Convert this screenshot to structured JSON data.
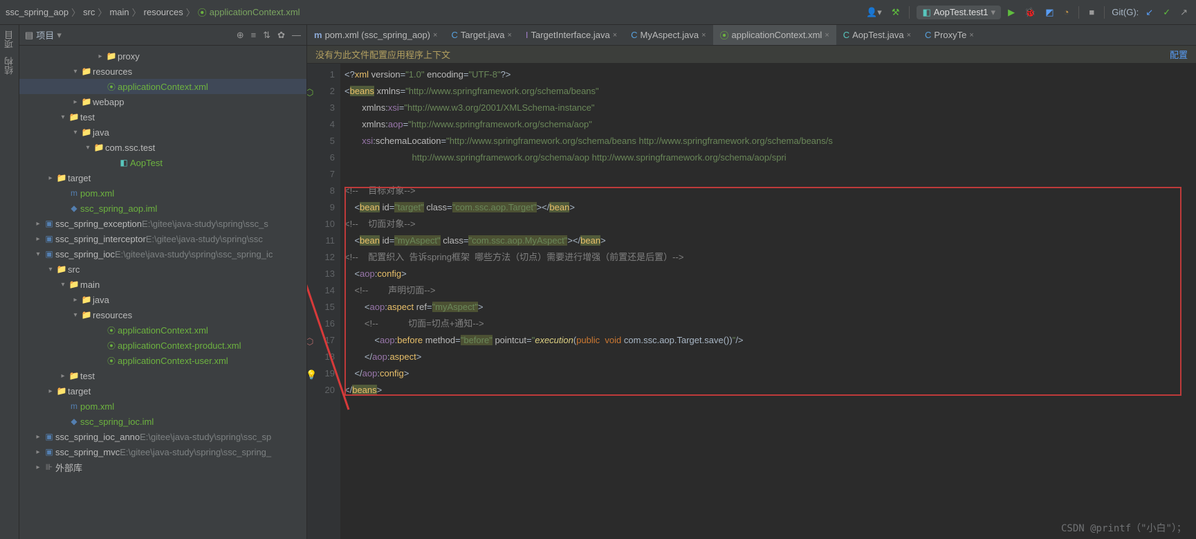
{
  "breadcrumbs": [
    "ssc_spring_aop",
    "src",
    "main",
    "resources",
    "applicationContext.xml"
  ],
  "run": {
    "config": "AopTest.test1",
    "git": "Git(G):"
  },
  "leftstrip": [
    "项目",
    "结构"
  ],
  "panel": {
    "title": "项目"
  },
  "tree": [
    {
      "d": 5,
      "a": "▸",
      "i": "folder",
      "c": "folder",
      "l": "proxy"
    },
    {
      "d": 3,
      "a": "▾",
      "i": "folder",
      "c": "folder",
      "l": "resources"
    },
    {
      "d": 5,
      "a": "",
      "i": "xml-spring",
      "c": "xml-spring",
      "l": "applicationContext.xml",
      "lc": "green",
      "sel": true
    },
    {
      "d": 3,
      "a": "▸",
      "i": "folder",
      "c": "folder",
      "l": "webapp"
    },
    {
      "d": 2,
      "a": "▾",
      "i": "folder",
      "c": "folder",
      "l": "test"
    },
    {
      "d": 3,
      "a": "▾",
      "i": "folder",
      "c": "folder-test",
      "l": "java"
    },
    {
      "d": 4,
      "a": "▾",
      "i": "folder",
      "c": "folder",
      "l": "com.ssc.test"
    },
    {
      "d": 6,
      "a": "",
      "i": "C",
      "c": "cls",
      "l": "AopTest",
      "lc": "green",
      "test": true
    },
    {
      "d": 1,
      "a": "▸",
      "i": "folder",
      "c": "folder-orange",
      "l": "target"
    },
    {
      "d": 2,
      "a": "",
      "i": "m",
      "c": "module",
      "l": "pom.xml",
      "lc": "green"
    },
    {
      "d": 2,
      "a": "",
      "i": "iml",
      "c": "module",
      "l": "ssc_spring_aop.iml",
      "lc": "green"
    },
    {
      "d": 0,
      "a": "▸",
      "i": "mod",
      "c": "module",
      "l": "ssc_spring_exception",
      "dim": "E:\\gitee\\java-study\\spring\\ssc_s"
    },
    {
      "d": 0,
      "a": "▸",
      "i": "mod",
      "c": "module",
      "l": "ssc_spring_interceptor",
      "dim": "E:\\gitee\\java-study\\spring\\ssc"
    },
    {
      "d": 0,
      "a": "▾",
      "i": "mod",
      "c": "module",
      "l": "ssc_spring_ioc",
      "dim": "E:\\gitee\\java-study\\spring\\ssc_spring_ic"
    },
    {
      "d": 1,
      "a": "▾",
      "i": "folder",
      "c": "folder",
      "l": "src"
    },
    {
      "d": 2,
      "a": "▾",
      "i": "folder",
      "c": "folder",
      "l": "main"
    },
    {
      "d": 3,
      "a": "▸",
      "i": "folder",
      "c": "folder-src",
      "l": "java"
    },
    {
      "d": 3,
      "a": "▾",
      "i": "folder",
      "c": "folder",
      "l": "resources"
    },
    {
      "d": 5,
      "a": "",
      "i": "xml-spring",
      "c": "xml-spring",
      "l": "applicationContext.xml",
      "lc": "green"
    },
    {
      "d": 5,
      "a": "",
      "i": "xml-spring",
      "c": "xml-spring",
      "l": "applicationContext-product.xml",
      "lc": "green"
    },
    {
      "d": 5,
      "a": "",
      "i": "xml-spring",
      "c": "xml-spring",
      "l": "applicationContext-user.xml",
      "lc": "green"
    },
    {
      "d": 2,
      "a": "▸",
      "i": "folder",
      "c": "folder",
      "l": "test"
    },
    {
      "d": 1,
      "a": "▸",
      "i": "folder",
      "c": "folder-orange",
      "l": "target"
    },
    {
      "d": 2,
      "a": "",
      "i": "m",
      "c": "module",
      "l": "pom.xml",
      "lc": "green"
    },
    {
      "d": 2,
      "a": "",
      "i": "iml",
      "c": "module",
      "l": "ssc_spring_ioc.iml",
      "lc": "green"
    },
    {
      "d": 0,
      "a": "▸",
      "i": "mod",
      "c": "module",
      "l": "ssc_spring_ioc_anno",
      "dim": "E:\\gitee\\java-study\\spring\\ssc_sp"
    },
    {
      "d": 0,
      "a": "▸",
      "i": "mod",
      "c": "module",
      "l": "ssc_spring_mvc",
      "dim": "E:\\gitee\\java-study\\spring\\ssc_spring_"
    },
    {
      "d": 0,
      "a": "▸",
      "i": "lib",
      "c": "lib",
      "l": "外部库"
    }
  ],
  "tabs": [
    {
      "i": "m",
      "c": "m",
      "t": "pom.xml (ssc_spring_aop)"
    },
    {
      "i": "C",
      "c": "cls",
      "t": "Target.java"
    },
    {
      "i": "I",
      "c": "in",
      "t": "TargetInterface.java"
    },
    {
      "i": "C",
      "c": "cls",
      "t": "MyAspect.java"
    },
    {
      "i": "⦿",
      "c": "spring",
      "t": "applicationContext.xml",
      "active": true
    },
    {
      "i": "C",
      "c": "test",
      "t": "AopTest.java"
    },
    {
      "i": "C",
      "c": "cls",
      "t": "ProxyTe"
    }
  ],
  "notice": {
    "msg": "没有为此文件配置应用程序上下文",
    "link": "配置"
  },
  "watermark": "CSDN @printf（\"小白\"）；"
}
